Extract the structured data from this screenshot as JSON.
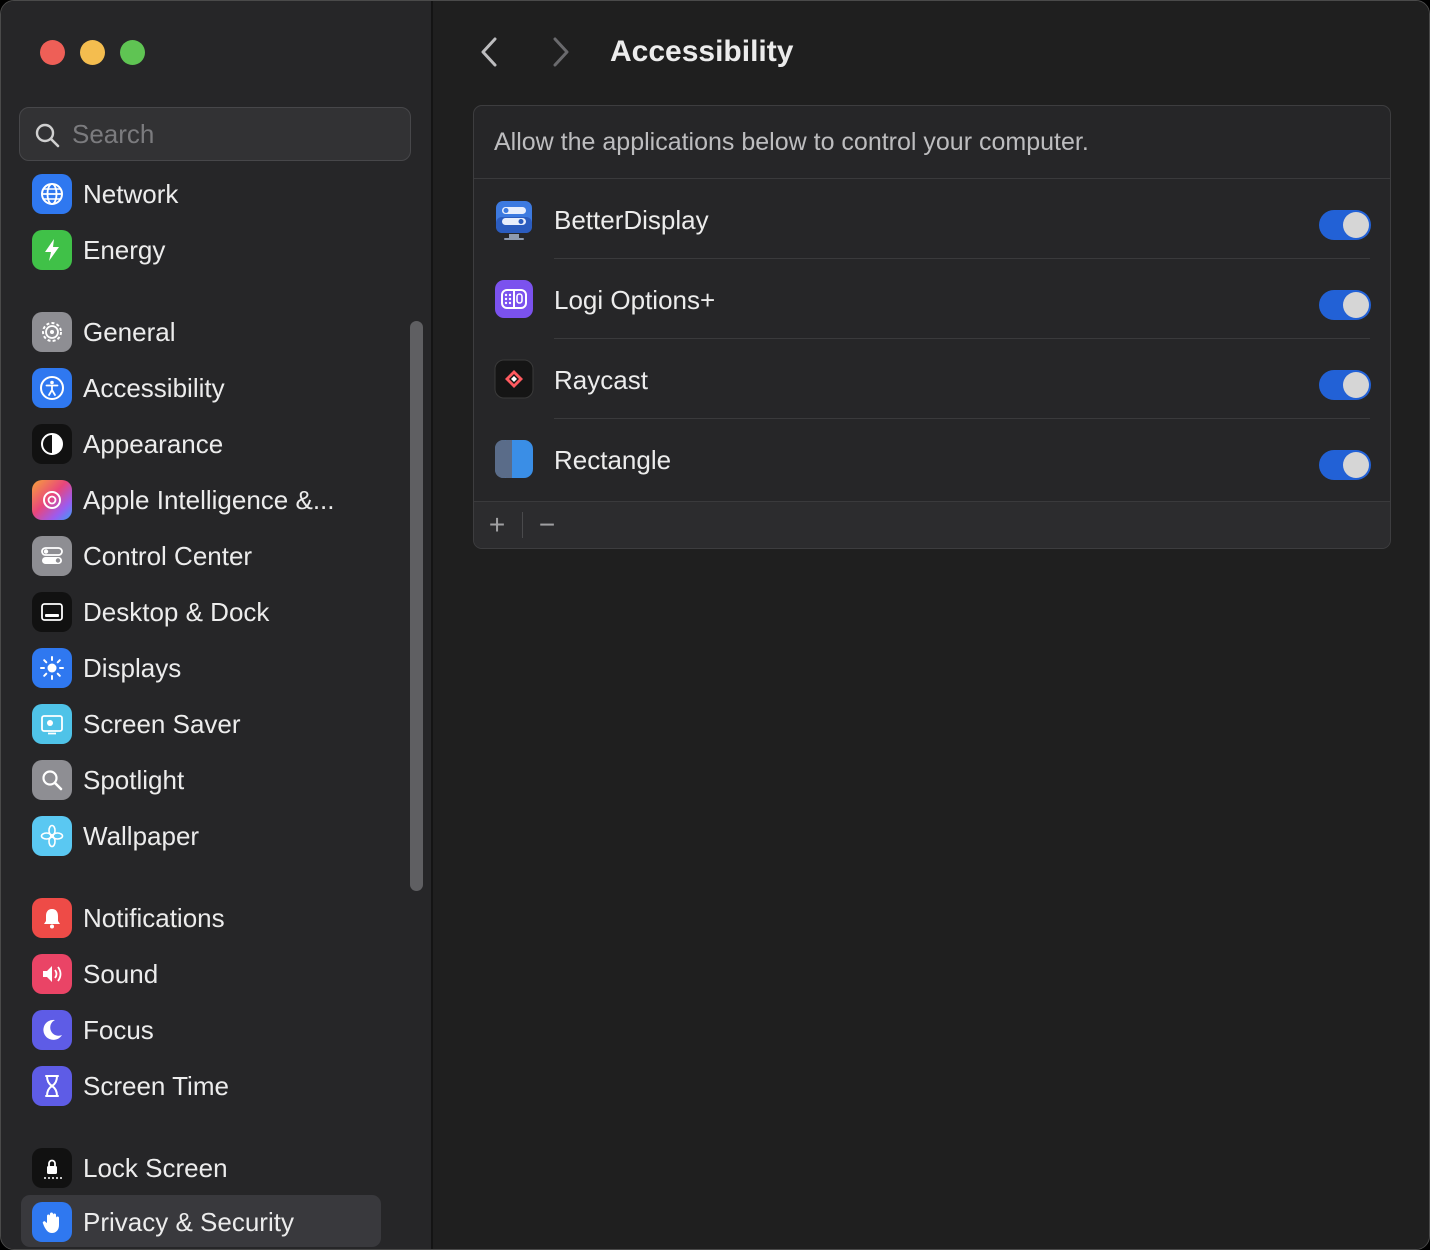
{
  "window": {
    "title": "Accessibility"
  },
  "search": {
    "placeholder": "Search",
    "value": ""
  },
  "sidebar": {
    "items": [
      {
        "label": "Network",
        "icon": "globe-icon"
      },
      {
        "label": "Energy",
        "icon": "bolt-icon"
      },
      {
        "label": "General",
        "icon": "gear-icon"
      },
      {
        "label": "Accessibility",
        "icon": "accessibility-icon"
      },
      {
        "label": "Appearance",
        "icon": "appearance-icon"
      },
      {
        "label": "Apple Intelligence &...",
        "icon": "apple-intelligence-icon"
      },
      {
        "label": "Control Center",
        "icon": "control-center-icon"
      },
      {
        "label": "Desktop & Dock",
        "icon": "dock-icon"
      },
      {
        "label": "Displays",
        "icon": "sun-icon"
      },
      {
        "label": "Screen Saver",
        "icon": "screen-saver-icon"
      },
      {
        "label": "Spotlight",
        "icon": "magnifier-icon"
      },
      {
        "label": "Wallpaper",
        "icon": "flower-icon"
      },
      {
        "label": "Notifications",
        "icon": "bell-icon"
      },
      {
        "label": "Sound",
        "icon": "speaker-icon"
      },
      {
        "label": "Focus",
        "icon": "moon-icon"
      },
      {
        "label": "Screen Time",
        "icon": "hourglass-icon"
      },
      {
        "label": "Lock Screen",
        "icon": "lock-icon"
      },
      {
        "label": "Privacy & Security",
        "icon": "hand-icon",
        "selected": true
      }
    ]
  },
  "main": {
    "header": "Allow the applications below to control your computer.",
    "apps": [
      {
        "name": "BetterDisplay",
        "enabled": true
      },
      {
        "name": "Logi Options+",
        "enabled": true
      },
      {
        "name": "Raycast",
        "enabled": true
      },
      {
        "name": "Rectangle",
        "enabled": true
      }
    ],
    "footer": {
      "add": "+",
      "remove": "−"
    }
  },
  "colors": {
    "accent": "#2261d6",
    "selection": "#39393d",
    "close": "#ee5f57",
    "minimize": "#f4bd4f",
    "maximize": "#5fc453"
  }
}
